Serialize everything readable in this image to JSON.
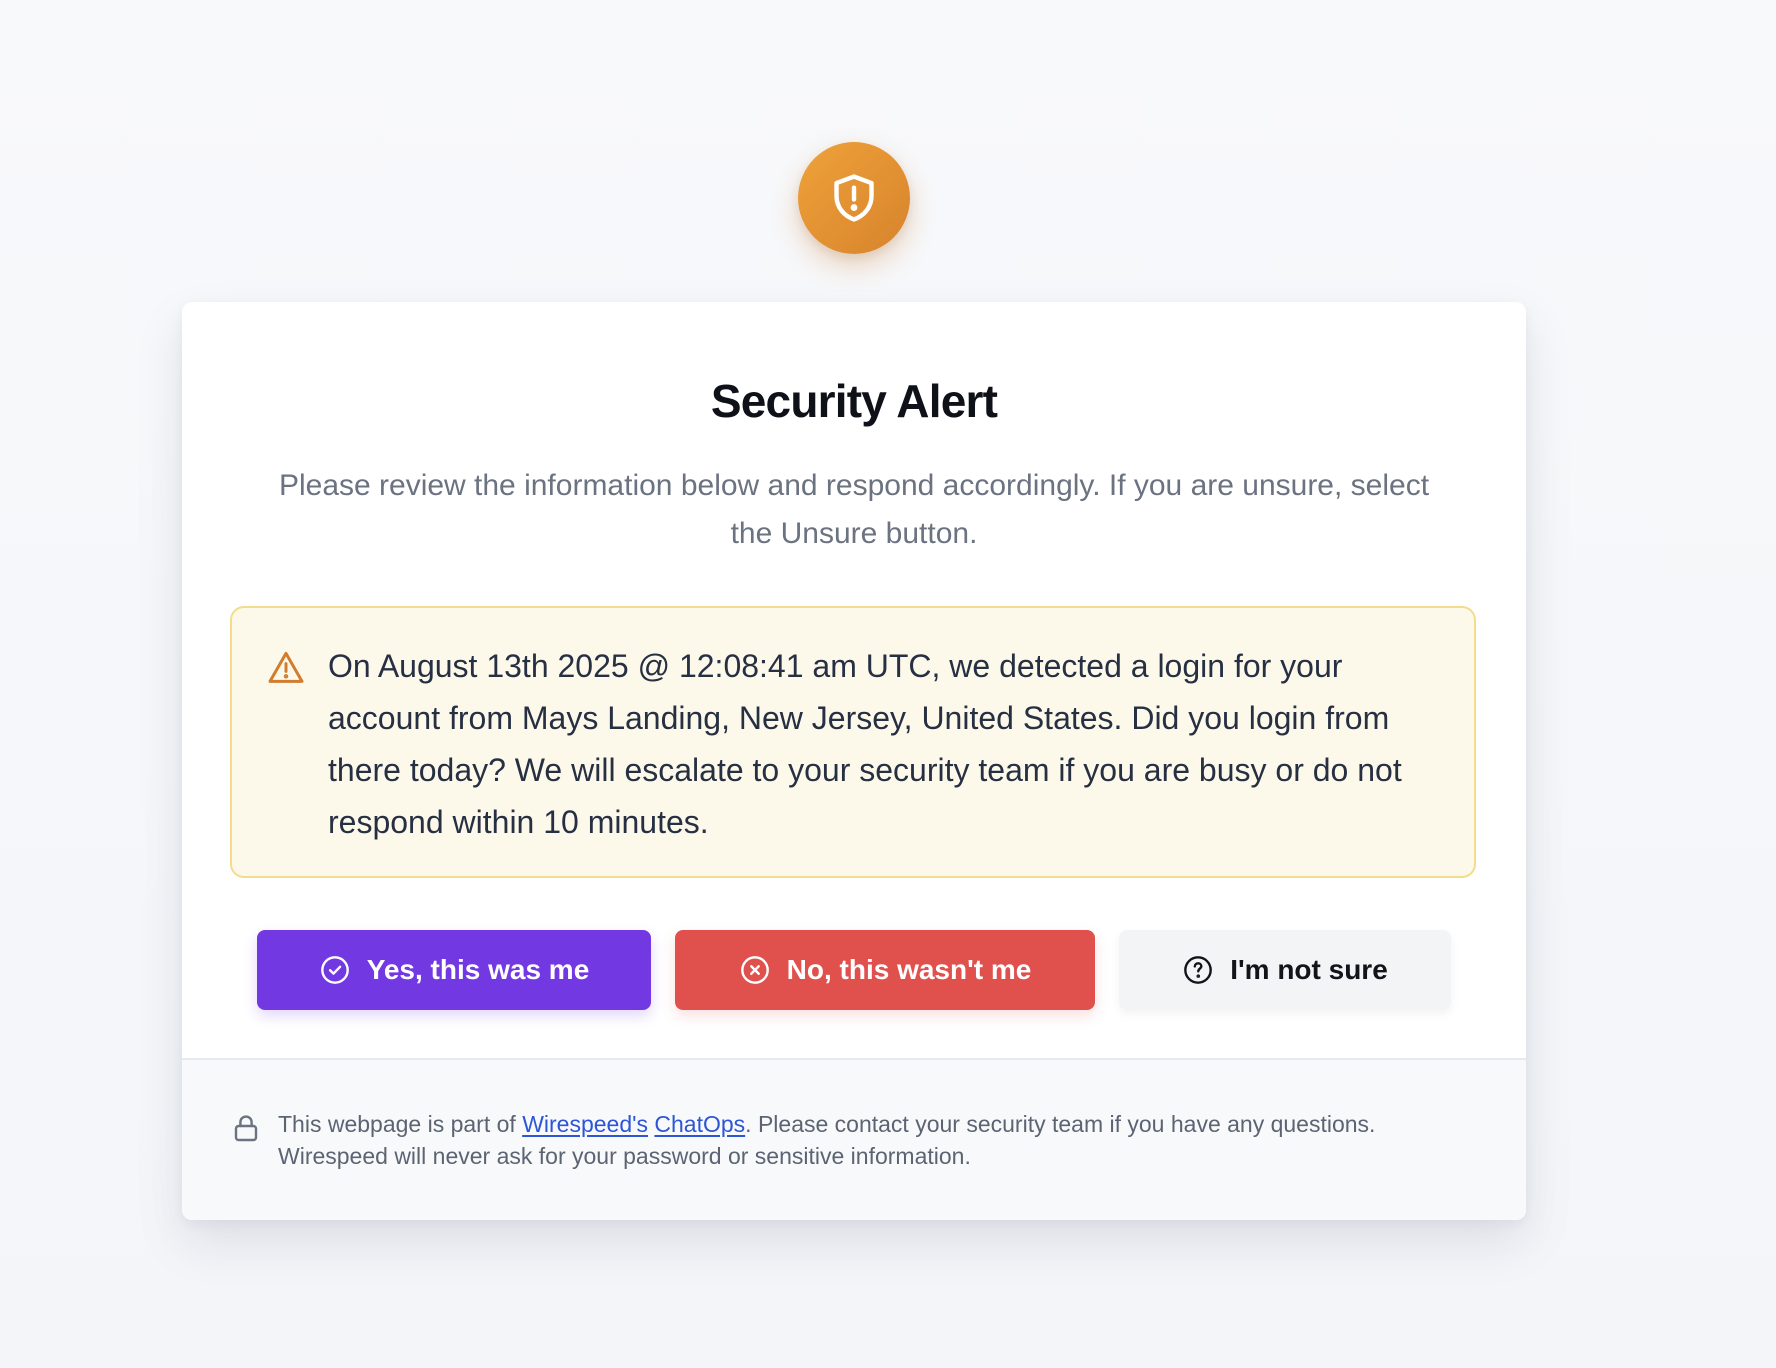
{
  "header": {
    "badge_icon": "shield-exclamation-icon",
    "badge_color": "#e59634"
  },
  "card": {
    "title": "Security Alert",
    "subtitle": "Please review the information below and respond accordingly. If you are unsure, select the Unsure button."
  },
  "alert": {
    "icon": "warning-triangle-icon",
    "message": "On August 13th 2025 @ 12:08:41 am UTC, we detected a login for your account from Mays Landing, New Jersey, United States. Did you login from there today? We will escalate to your security team if you are busy or do not respond within 10 minutes.",
    "background": "#fdf9ea",
    "border": "#f3dc8c"
  },
  "actions": {
    "yes_label": "Yes, this was me",
    "yes_icon": "check-circle-icon",
    "yes_color": "#7239e3",
    "no_label": "No, this wasn't me",
    "no_icon": "x-circle-icon",
    "no_color": "#e0514d",
    "unsure_label": "I'm not sure",
    "unsure_icon": "question-circle-icon",
    "unsure_color": "#f3f4f6"
  },
  "footer": {
    "icon": "lock-icon",
    "text_before": "This webpage is part of ",
    "link_wirespeed": "Wirespeed's",
    "link_space": " ",
    "link_chatops": "ChatOps",
    "text_after": ". Please contact your security team if you have any questions. Wirespeed will never ask for your password or sensitive information."
  }
}
